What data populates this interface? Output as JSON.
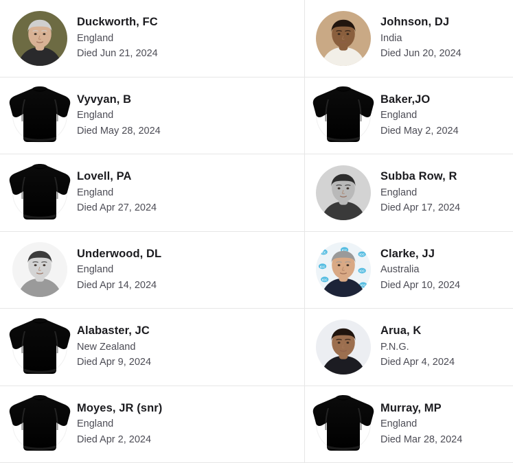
{
  "page": {
    "title": "Cricket obituaries list",
    "died_prefix": "Died",
    "layout": {
      "columns": 2,
      "rows": 6
    },
    "colors": {
      "background": "#ffffff",
      "name_text": "#1b1b1f",
      "meta_text": "#4c4c55",
      "divider": "#e6e6e6",
      "placeholder_jersey": "#000000"
    }
  },
  "entries": [
    {
      "name": "Duckworth, FC",
      "country": "England",
      "died": "Died Jun 21, 2024",
      "avatar": {
        "type": "photo",
        "icon": "portrait-photo",
        "description": "elderly man with glasses, olive background",
        "bg": "#6d6b43",
        "skin": "#d8b295",
        "hair": "#cfcfcf",
        "clothing": "#2a2a2c"
      }
    },
    {
      "name": "Johnson, DJ",
      "country": "India",
      "died": "Died Jun 20, 2024",
      "avatar": {
        "type": "photo",
        "icon": "portrait-photo",
        "description": "man in white cricket shirt looking down",
        "bg": "#c9a985",
        "skin": "#8a5f3d",
        "hair": "#22160f",
        "clothing": "#f2efe8"
      }
    },
    {
      "name": "Vyvyan, B",
      "country": "England",
      "died": "Died May 28, 2024",
      "avatar": {
        "type": "placeholder",
        "icon": "jersey-placeholder-icon",
        "description": "black cricket shirt silhouette"
      }
    },
    {
      "name": "Baker,JO",
      "country": "England",
      "died": "Died May 2, 2024",
      "avatar": {
        "type": "placeholder",
        "icon": "jersey-placeholder-icon",
        "description": "black cricket shirt silhouette"
      }
    },
    {
      "name": "Lovell, PA",
      "country": "England",
      "died": "Died Apr 27, 2024",
      "avatar": {
        "type": "placeholder",
        "icon": "jersey-placeholder-icon",
        "description": "black cricket shirt silhouette"
      }
    },
    {
      "name": "Subba Row, R",
      "country": "England",
      "died": "Died Apr 17, 2024",
      "avatar": {
        "type": "photo",
        "icon": "portrait-photo",
        "description": "black and white portrait of man in suit",
        "bg": "#d3d3d3",
        "skin": "#b9b9b9",
        "hair": "#2d2d2d",
        "clothing": "#3a3a3a"
      }
    },
    {
      "name": "Underwood, DL",
      "country": "England",
      "died": "Died Apr 14, 2024",
      "avatar": {
        "type": "photo",
        "icon": "portrait-photo",
        "description": "black and white portrait of smiling young man",
        "bg": "#f4f4f4",
        "skin": "#d4d4d4",
        "hair": "#3c3c3c",
        "clothing": "#9a9a9a"
      }
    },
    {
      "name": "Clarke, JJ",
      "country": "Australia",
      "died": "Died Apr 10, 2024",
      "avatar": {
        "type": "photo",
        "icon": "portrait-photo",
        "description": "man in suit and tie in front of ICC logo backdrop",
        "bg": "#eef4f8",
        "skin": "#d9a985",
        "hair": "#9a9a9a",
        "clothing": "#1d2438",
        "accent": "#0aa0d6"
      }
    },
    {
      "name": "Alabaster, JC",
      "country": "New Zealand",
      "died": "Died Apr 9, 2024",
      "avatar": {
        "type": "placeholder",
        "icon": "jersey-placeholder-icon",
        "description": "black cricket shirt silhouette"
      }
    },
    {
      "name": "Arua, K",
      "country": "P.N.G.",
      "died": "Died Apr 4, 2024",
      "avatar": {
        "type": "photo",
        "icon": "portrait-photo",
        "description": "woman with earrings in dark top",
        "bg": "#eceef2",
        "skin": "#9c6f4f",
        "hair": "#20150f",
        "clothing": "#1c1c22"
      }
    },
    {
      "name": "Moyes, JR (snr)",
      "country": "England",
      "died": "Died Apr 2, 2024",
      "avatar": {
        "type": "placeholder",
        "icon": "jersey-placeholder-icon",
        "description": "black cricket shirt silhouette"
      }
    },
    {
      "name": "Murray, MP",
      "country": "England",
      "died": "Died Mar 28, 2024",
      "avatar": {
        "type": "placeholder",
        "icon": "jersey-placeholder-icon",
        "description": "black cricket shirt silhouette"
      }
    }
  ]
}
